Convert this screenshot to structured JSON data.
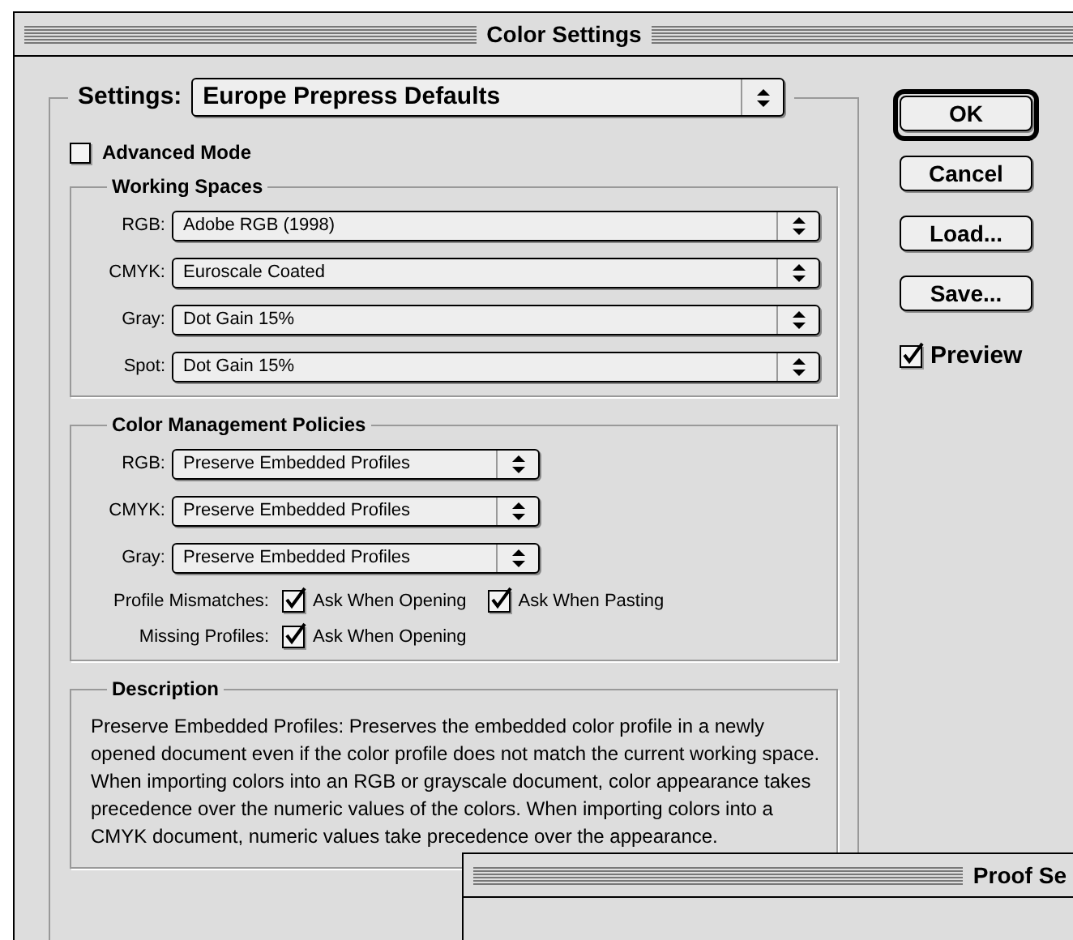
{
  "window": {
    "title": "Color Settings"
  },
  "settings": {
    "label": "Settings:",
    "value": "Europe Prepress Defaults"
  },
  "advanced_mode": {
    "label": "Advanced Mode",
    "checked": false
  },
  "working_spaces": {
    "title": "Working Spaces",
    "fields": [
      {
        "label": "RGB:",
        "value": "Adobe RGB (1998)"
      },
      {
        "label": "CMYK:",
        "value": "Euroscale Coated"
      },
      {
        "label": "Gray:",
        "value": "Dot Gain 15%"
      },
      {
        "label": "Spot:",
        "value": "Dot Gain 15%"
      }
    ]
  },
  "policies": {
    "title": "Color Management Policies",
    "fields": [
      {
        "label": "RGB:",
        "value": "Preserve Embedded Profiles"
      },
      {
        "label": "CMYK:",
        "value": "Preserve Embedded Profiles"
      },
      {
        "label": "Gray:",
        "value": "Preserve Embedded Profiles"
      }
    ],
    "checks": [
      {
        "label": "Profile Mismatches:",
        "options": [
          {
            "label": "Ask When Opening",
            "checked": true
          },
          {
            "label": "Ask When Pasting",
            "checked": true
          }
        ]
      },
      {
        "label": "Missing Profiles:",
        "options": [
          {
            "label": "Ask When Opening",
            "checked": true
          }
        ]
      }
    ]
  },
  "description": {
    "title": "Description",
    "text": "Preserve Embedded Profiles:  Preserves the embedded color profile in a newly opened document even if the color profile does not match the current working space.  When importing colors into an RGB or grayscale document, color appearance takes precedence over the numeric values of the colors. When importing colors into a CMYK document, numeric values take precedence over the appearance."
  },
  "buttons": [
    {
      "label": "OK",
      "default": true
    },
    {
      "label": "Cancel",
      "default": false
    },
    {
      "label": "Load...",
      "default": false
    },
    {
      "label": "Save...",
      "default": false
    }
  ],
  "preview": {
    "label": "Preview",
    "checked": true
  },
  "proof_window": {
    "title": "Proof Se"
  }
}
